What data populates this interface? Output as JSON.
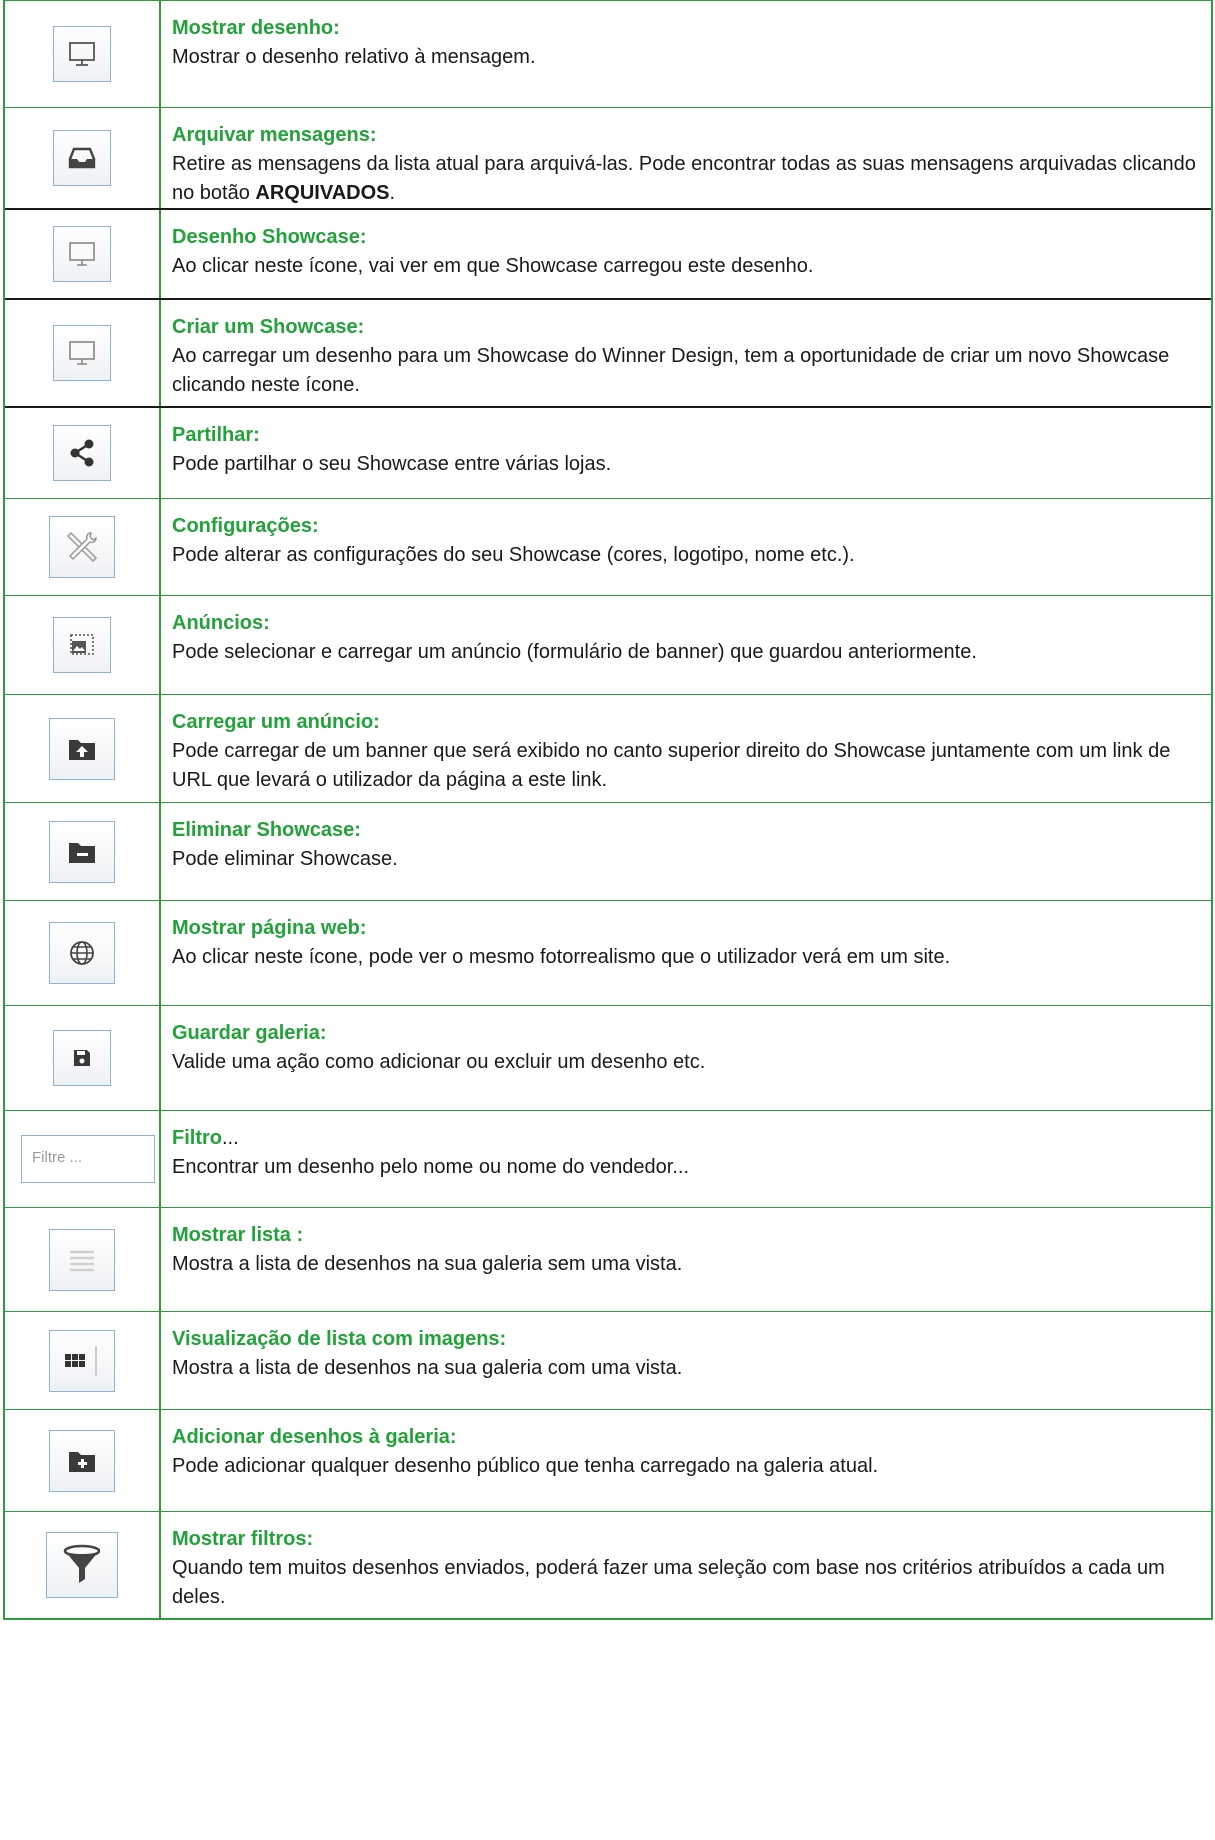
{
  "rows": [
    {
      "icon": "monitor-icon",
      "title": "Mostrar desenho:",
      "desc": "Mostrar o desenho relativo à mensagem."
    },
    {
      "icon": "archive-tray-icon",
      "title": "Arquivar mensagens:",
      "desc_pre": "Retire as mensagens da lista atual para arquivá-las. Pode encontrar todas as suas mensagens arquivadas clicando no botão ",
      "desc_bold": "ARQUIVADOS",
      "desc_post": "."
    },
    {
      "icon": "monitor-icon",
      "title": "Desenho Showcase:",
      "desc": "Ao clicar neste ícone, vai ver em que Showcase carregou este desenho."
    },
    {
      "icon": "monitor-icon",
      "title": "Criar um Showcase:",
      "desc": "Ao carregar um desenho para um Showcase do Winner Design, tem a oportunidade de criar um novo Showcase clicando neste ícone."
    },
    {
      "icon": "share-icon",
      "title": "Partilhar:",
      "desc": "Pode partilhar o seu Showcase entre várias lojas."
    },
    {
      "icon": "tools-icon",
      "title": "Configurações:",
      "desc": "Pode alterar as configurações do seu Showcase (cores, logotipo, nome etc.)."
    },
    {
      "icon": "banner-image-icon",
      "title": "Anúncios:",
      "desc": "Pode selecionar e carregar um anúncio (formulário de banner) que guardou anteriormente."
    },
    {
      "icon": "folder-upload-icon",
      "title": "Carregar um anúncio:",
      "desc": "Pode carregar de um banner que será exibido no canto superior direito do Showcase juntamente com um link de URL que levará o utilizador da página a este link."
    },
    {
      "icon": "folder-minus-icon",
      "title": "Eliminar Showcase:",
      "desc": "Pode eliminar Showcase."
    },
    {
      "icon": "globe-icon",
      "title": "Mostrar página web:",
      "desc": "Ao clicar neste ícone, pode ver o mesmo fotorrealismo que o utilizador verá em um site."
    },
    {
      "icon": "save-icon",
      "title": "Guardar galeria:",
      "desc": "Valide uma ação como adicionar ou excluir um desenho etc."
    },
    {
      "icon": "filter-input",
      "title": "Filtro",
      "title_suffix": "...",
      "placeholder": "Filtre ...",
      "desc": "Encontrar um desenho pelo nome ou nome do vendedor..."
    },
    {
      "icon": "list-icon",
      "title": "Mostrar lista :",
      "desc": "Mostra a lista de desenhos na sua galeria sem uma vista."
    },
    {
      "icon": "grid-icon",
      "title": "Visualização de lista com imagens:",
      "desc": "Mostra a lista de desenhos na sua galeria com uma vista."
    },
    {
      "icon": "folder-plus-icon",
      "title": "Adicionar desenhos à galeria:",
      "desc": "Pode adicionar qualquer desenho público que tenha carregado na galeria atual."
    },
    {
      "icon": "funnel-icon",
      "title": "Mostrar filtros:",
      "desc": "Quando tem muitos desenhos enviados, poderá fazer uma seleção com base nos critérios atribuídos a cada um deles."
    }
  ],
  "colors": {
    "accent": "#22a33a",
    "border": "#2e9e3a",
    "text": "#1a1a1a"
  }
}
